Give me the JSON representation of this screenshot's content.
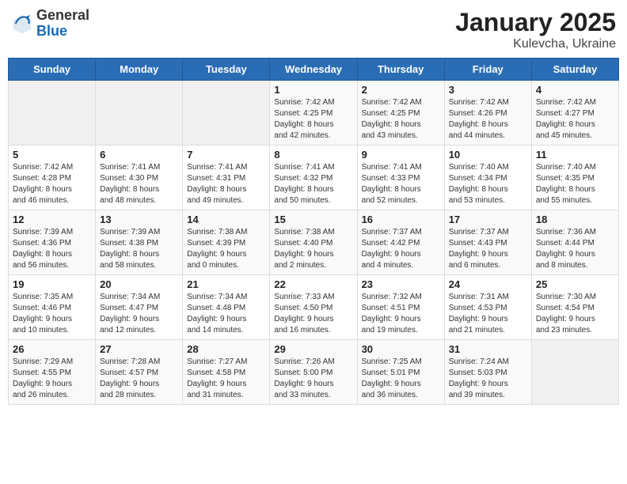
{
  "header": {
    "logo_general": "General",
    "logo_blue": "Blue",
    "title": "January 2025",
    "subtitle": "Kulevcha, Ukraine"
  },
  "weekdays": [
    "Sunday",
    "Monday",
    "Tuesday",
    "Wednesday",
    "Thursday",
    "Friday",
    "Saturday"
  ],
  "weeks": [
    [
      {
        "day": "",
        "info": ""
      },
      {
        "day": "",
        "info": ""
      },
      {
        "day": "",
        "info": ""
      },
      {
        "day": "1",
        "info": "Sunrise: 7:42 AM\nSunset: 4:25 PM\nDaylight: 8 hours\nand 42 minutes."
      },
      {
        "day": "2",
        "info": "Sunrise: 7:42 AM\nSunset: 4:25 PM\nDaylight: 8 hours\nand 43 minutes."
      },
      {
        "day": "3",
        "info": "Sunrise: 7:42 AM\nSunset: 4:26 PM\nDaylight: 8 hours\nand 44 minutes."
      },
      {
        "day": "4",
        "info": "Sunrise: 7:42 AM\nSunset: 4:27 PM\nDaylight: 8 hours\nand 45 minutes."
      }
    ],
    [
      {
        "day": "5",
        "info": "Sunrise: 7:42 AM\nSunset: 4:28 PM\nDaylight: 8 hours\nand 46 minutes."
      },
      {
        "day": "6",
        "info": "Sunrise: 7:41 AM\nSunset: 4:30 PM\nDaylight: 8 hours\nand 48 minutes."
      },
      {
        "day": "7",
        "info": "Sunrise: 7:41 AM\nSunset: 4:31 PM\nDaylight: 8 hours\nand 49 minutes."
      },
      {
        "day": "8",
        "info": "Sunrise: 7:41 AM\nSunset: 4:32 PM\nDaylight: 8 hours\nand 50 minutes."
      },
      {
        "day": "9",
        "info": "Sunrise: 7:41 AM\nSunset: 4:33 PM\nDaylight: 8 hours\nand 52 minutes."
      },
      {
        "day": "10",
        "info": "Sunrise: 7:40 AM\nSunset: 4:34 PM\nDaylight: 8 hours\nand 53 minutes."
      },
      {
        "day": "11",
        "info": "Sunrise: 7:40 AM\nSunset: 4:35 PM\nDaylight: 8 hours\nand 55 minutes."
      }
    ],
    [
      {
        "day": "12",
        "info": "Sunrise: 7:39 AM\nSunset: 4:36 PM\nDaylight: 8 hours\nand 56 minutes."
      },
      {
        "day": "13",
        "info": "Sunrise: 7:39 AM\nSunset: 4:38 PM\nDaylight: 8 hours\nand 58 minutes."
      },
      {
        "day": "14",
        "info": "Sunrise: 7:38 AM\nSunset: 4:39 PM\nDaylight: 9 hours\nand 0 minutes."
      },
      {
        "day": "15",
        "info": "Sunrise: 7:38 AM\nSunset: 4:40 PM\nDaylight: 9 hours\nand 2 minutes."
      },
      {
        "day": "16",
        "info": "Sunrise: 7:37 AM\nSunset: 4:42 PM\nDaylight: 9 hours\nand 4 minutes."
      },
      {
        "day": "17",
        "info": "Sunrise: 7:37 AM\nSunset: 4:43 PM\nDaylight: 9 hours\nand 6 minutes."
      },
      {
        "day": "18",
        "info": "Sunrise: 7:36 AM\nSunset: 4:44 PM\nDaylight: 9 hours\nand 8 minutes."
      }
    ],
    [
      {
        "day": "19",
        "info": "Sunrise: 7:35 AM\nSunset: 4:46 PM\nDaylight: 9 hours\nand 10 minutes."
      },
      {
        "day": "20",
        "info": "Sunrise: 7:34 AM\nSunset: 4:47 PM\nDaylight: 9 hours\nand 12 minutes."
      },
      {
        "day": "21",
        "info": "Sunrise: 7:34 AM\nSunset: 4:48 PM\nDaylight: 9 hours\nand 14 minutes."
      },
      {
        "day": "22",
        "info": "Sunrise: 7:33 AM\nSunset: 4:50 PM\nDaylight: 9 hours\nand 16 minutes."
      },
      {
        "day": "23",
        "info": "Sunrise: 7:32 AM\nSunset: 4:51 PM\nDaylight: 9 hours\nand 19 minutes."
      },
      {
        "day": "24",
        "info": "Sunrise: 7:31 AM\nSunset: 4:53 PM\nDaylight: 9 hours\nand 21 minutes."
      },
      {
        "day": "25",
        "info": "Sunrise: 7:30 AM\nSunset: 4:54 PM\nDaylight: 9 hours\nand 23 minutes."
      }
    ],
    [
      {
        "day": "26",
        "info": "Sunrise: 7:29 AM\nSunset: 4:55 PM\nDaylight: 9 hours\nand 26 minutes."
      },
      {
        "day": "27",
        "info": "Sunrise: 7:28 AM\nSunset: 4:57 PM\nDaylight: 9 hours\nand 28 minutes."
      },
      {
        "day": "28",
        "info": "Sunrise: 7:27 AM\nSunset: 4:58 PM\nDaylight: 9 hours\nand 31 minutes."
      },
      {
        "day": "29",
        "info": "Sunrise: 7:26 AM\nSunset: 5:00 PM\nDaylight: 9 hours\nand 33 minutes."
      },
      {
        "day": "30",
        "info": "Sunrise: 7:25 AM\nSunset: 5:01 PM\nDaylight: 9 hours\nand 36 minutes."
      },
      {
        "day": "31",
        "info": "Sunrise: 7:24 AM\nSunset: 5:03 PM\nDaylight: 9 hours\nand 39 minutes."
      },
      {
        "day": "",
        "info": ""
      }
    ]
  ]
}
